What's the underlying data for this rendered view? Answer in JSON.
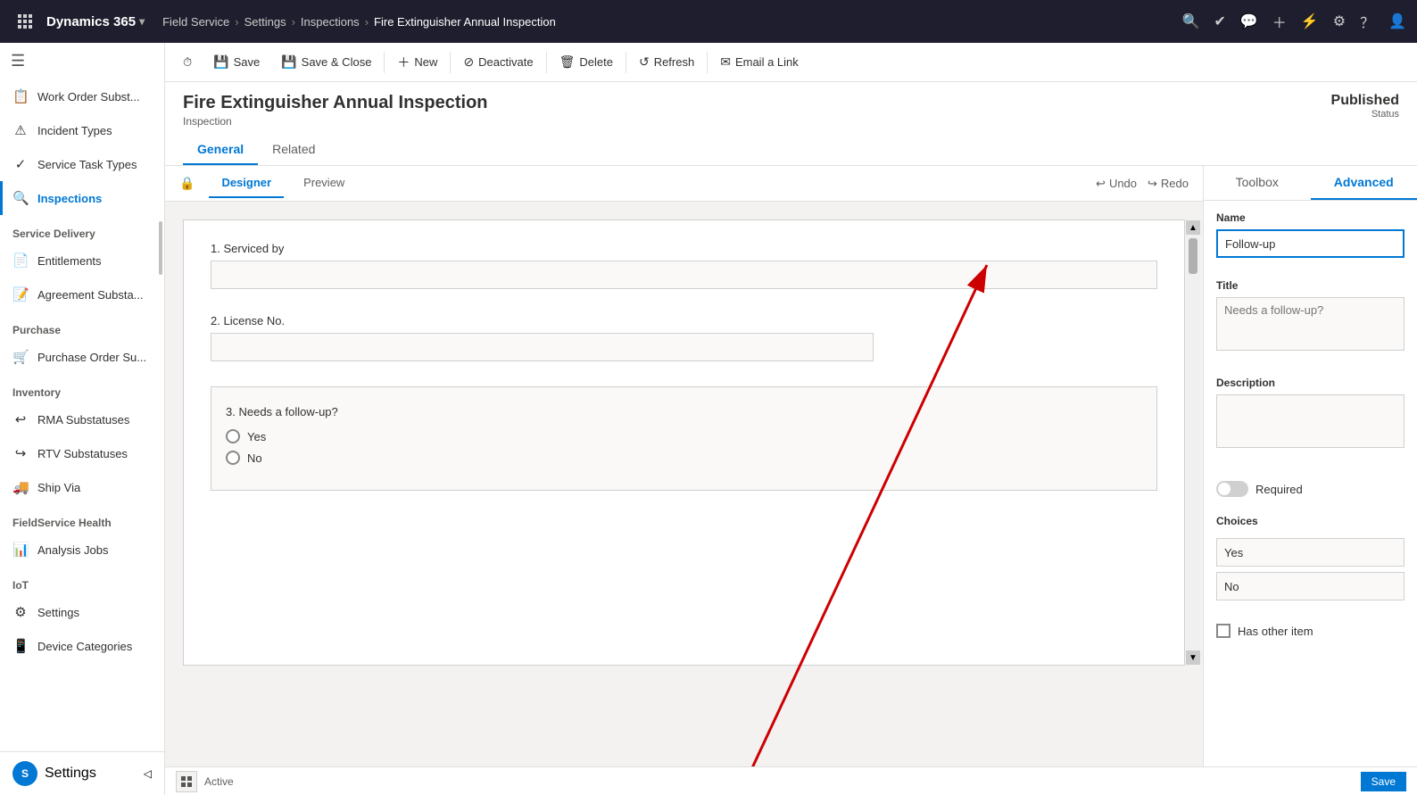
{
  "topNav": {
    "appName": "Dynamics 365",
    "moduleName": "Field Service",
    "breadcrumbs": [
      "Settings",
      "Inspections",
      "Fire Extinguisher Annual Inspection"
    ],
    "icons": [
      "search",
      "checkmark-circle",
      "help-circle",
      "plus",
      "filter",
      "settings-gear",
      "help",
      "user"
    ]
  },
  "sidebar": {
    "toggleIcon": "☰",
    "sections": [
      {
        "items": [
          {
            "id": "work-order-subst",
            "label": "Work Order Subst...",
            "icon": "📋"
          },
          {
            "id": "incident-types",
            "label": "Incident Types",
            "icon": "⚠"
          },
          {
            "id": "service-task-types",
            "label": "Service Task Types",
            "icon": "✓"
          },
          {
            "id": "inspections",
            "label": "Inspections",
            "icon": "🔍",
            "active": true
          }
        ]
      },
      {
        "header": "Service Delivery",
        "items": [
          {
            "id": "entitlements",
            "label": "Entitlements",
            "icon": "📄"
          },
          {
            "id": "agreement-substa",
            "label": "Agreement Substa...",
            "icon": "📝"
          }
        ]
      },
      {
        "header": "Purchase",
        "items": [
          {
            "id": "purchase-order-su",
            "label": "Purchase Order Su...",
            "icon": "🛒"
          }
        ]
      },
      {
        "header": "Inventory",
        "items": [
          {
            "id": "rma-substatuses",
            "label": "RMA Substatuses",
            "icon": "↩"
          },
          {
            "id": "rtv-substatuses",
            "label": "RTV Substatuses",
            "icon": "↪"
          },
          {
            "id": "ship-via",
            "label": "Ship Via",
            "icon": "🚚"
          }
        ]
      },
      {
        "header": "FieldService Health",
        "items": [
          {
            "id": "analysis-jobs",
            "label": "Analysis Jobs",
            "icon": "📊"
          }
        ]
      },
      {
        "header": "IoT",
        "items": [
          {
            "id": "settings",
            "label": "Settings",
            "icon": "⚙"
          },
          {
            "id": "device-categories",
            "label": "Device Categories",
            "icon": "📱"
          }
        ]
      }
    ],
    "bottomUser": {
      "label": "Settings",
      "avatar": "S"
    }
  },
  "commandBar": {
    "buttons": [
      {
        "id": "save",
        "label": "Save",
        "icon": "💾"
      },
      {
        "id": "save-close",
        "label": "Save & Close",
        "icon": "💾"
      },
      {
        "id": "new",
        "label": "New",
        "icon": "+"
      },
      {
        "id": "deactivate",
        "label": "Deactivate",
        "icon": "⊘"
      },
      {
        "id": "delete",
        "label": "Delete",
        "icon": "🗑"
      },
      {
        "id": "refresh",
        "label": "Refresh",
        "icon": "↺"
      },
      {
        "id": "email-link",
        "label": "Email a Link",
        "icon": "✉"
      }
    ]
  },
  "record": {
    "title": "Fire Extinguisher Annual Inspection",
    "subtitle": "Inspection",
    "status": "Published",
    "statusLabel": "Status",
    "tabs": [
      "General",
      "Related"
    ]
  },
  "designerTabs": [
    "Designer",
    "Preview"
  ],
  "undoRedo": {
    "undoLabel": "Undo",
    "redoLabel": "Redo"
  },
  "formQuestions": [
    {
      "number": "1.",
      "label": "Serviced by",
      "type": "input"
    },
    {
      "number": "2.",
      "label": "License No.",
      "type": "input"
    },
    {
      "number": "3.",
      "label": "Needs a follow-up?",
      "type": "radio",
      "options": [
        "Yes",
        "No"
      ]
    }
  ],
  "rightPanel": {
    "tabs": [
      "Toolbox",
      "Advanced"
    ],
    "activeTab": "Advanced",
    "fields": {
      "name": {
        "label": "Name",
        "value": "Follow-up"
      },
      "title": {
        "label": "Title",
        "placeholder": "Needs a follow-up?"
      },
      "description": {
        "label": "Description",
        "placeholder": ""
      }
    },
    "required": {
      "label": "Required"
    },
    "choices": {
      "label": "Choices",
      "items": [
        "Yes",
        "No"
      ]
    },
    "hasOtherItem": {
      "label": "Has other item",
      "checked": false
    }
  },
  "statusBar": {
    "gridIconTitle": "grid",
    "statusText": "Active",
    "saveLabel": "Save"
  }
}
